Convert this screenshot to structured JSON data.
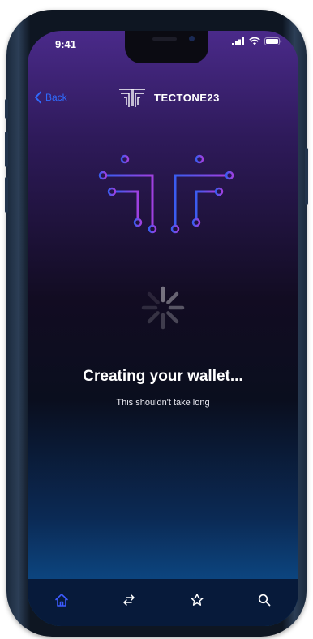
{
  "status_bar": {
    "time": "9:41"
  },
  "nav": {
    "back_label": "Back",
    "brand_name": "TECTONE23"
  },
  "loading": {
    "title": "Creating your wallet...",
    "subtitle": "This shouldn't take long"
  },
  "tabbar": {
    "tabs": [
      {
        "icon": "home-icon",
        "active": true
      },
      {
        "icon": "swap-arrows-icon",
        "active": false
      },
      {
        "icon": "star-icon",
        "active": false
      },
      {
        "icon": "search-icon",
        "active": false
      }
    ]
  },
  "colors": {
    "accent": "#2f6bff",
    "active_tab": "#3d5bff",
    "inactive_tab": "#ffffff",
    "logo_start": "#3a5cf0",
    "logo_end": "#a040e0"
  }
}
